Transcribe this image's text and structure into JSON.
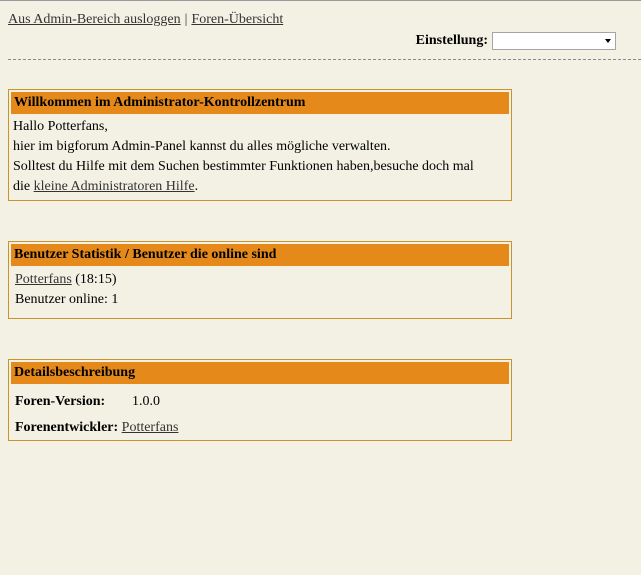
{
  "nav": {
    "logout": "Aus Admin-Bereich ausloggen",
    "separator": "|",
    "overview": "Foren-Übersicht"
  },
  "setting": {
    "label": "Einstellung:",
    "selected": ""
  },
  "welcome": {
    "title": "Willkommen im Administrator-Kontrollzentrum",
    "greeting": "Hallo Potterfans,",
    "line1": "hier im bigforum Admin-Panel kannst du alles mögliche verwalten.",
    "line2": "Solltest du Hilfe mit dem Suchen bestimmter Funktionen haben,besuche doch mal",
    "line3_prefix": "die",
    "help_link": "kleine Administratoren Hilfe",
    "line3_suffix": "."
  },
  "stats": {
    "title": "Benutzer Statistik / Benutzer die online sind",
    "user": "Potterfans",
    "time": "(18:15)",
    "online": "Benutzer online: 1"
  },
  "details": {
    "title": "Detailsbeschreibung",
    "version_label": "Foren-Version:",
    "version_value": "1.0.0",
    "dev_label": "Forenentwickler:",
    "dev_link": "Potterfans"
  }
}
